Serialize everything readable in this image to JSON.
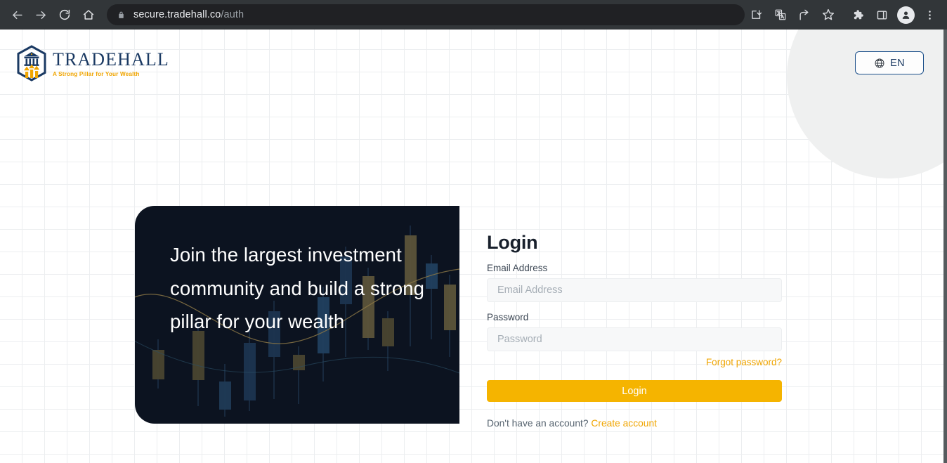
{
  "browser": {
    "back_icon": "back-arrow-icon",
    "forward_icon": "forward-arrow-icon",
    "reload_icon": "reload-icon",
    "home_icon": "home-icon",
    "lock_icon": "lock-icon",
    "url_domain": "secure.tradehall.co",
    "url_path": "/auth",
    "toolbar_icons": [
      "install-app-icon",
      "translate-icon",
      "share-icon",
      "bookmark-star-icon",
      "extensions-puzzle-icon",
      "side-panel-icon",
      "profile-avatar-icon",
      "three-dot-menu-icon"
    ]
  },
  "header": {
    "logo_icon": "tradehall-hexagon-pillar-icon",
    "brand_name": "TRADEHALL",
    "tagline": "A Strong Pillar for Your Wealth",
    "language": {
      "icon": "globe-icon",
      "label": "EN"
    }
  },
  "hero": {
    "headline": "Join the largest investment community and build a strong pillar for your wealth",
    "background_icon": "candlestick-chart-icon"
  },
  "login": {
    "title": "Login",
    "email_label": "Email Address",
    "email_placeholder": "Email Address",
    "email_value": "",
    "password_label": "Password",
    "password_placeholder": "Password",
    "password_value": "",
    "forgot_password": "Forgot password?",
    "submit_label": "Login",
    "signup_prompt": "Don't have an account?",
    "signup_link": "Create account"
  },
  "colors": {
    "brand_navy": "#1b3a63",
    "brand_amber": "#f5b400",
    "hero_dark": "#0c1320",
    "chrome_dark": "#323639"
  }
}
